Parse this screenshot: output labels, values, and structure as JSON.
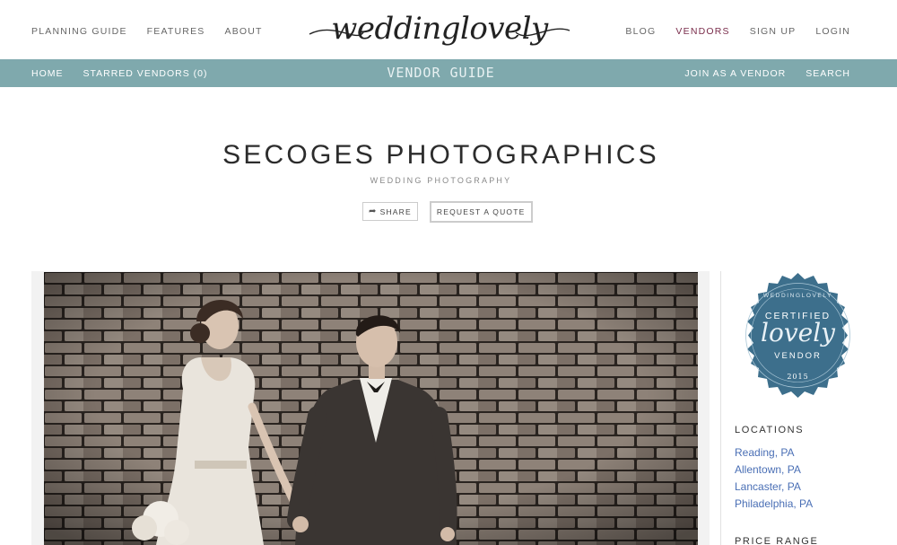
{
  "header": {
    "logo_text": "weddinglovely",
    "left_nav": [
      "PLANNING GUIDE",
      "FEATURES",
      "ABOUT"
    ],
    "right_nav": [
      "BLOG",
      "VENDORS",
      "SIGN UP",
      "LOGIN"
    ],
    "active_item": "VENDORS",
    "active_color": "#7a2d4b"
  },
  "subnav": {
    "bar_color": "#7fa9ad",
    "title": "VENDOR GUIDE",
    "left_items": [
      "HOME",
      "STARRED VENDORS (0)"
    ],
    "right_items": [
      "JOIN AS A VENDOR",
      "SEARCH"
    ]
  },
  "vendor": {
    "name": "SECOGES PHOTOGRAPHICS",
    "category": "WEDDING PHOTOGRAPHY",
    "share_label": "SHARE",
    "share_icon": "share-arrow-icon",
    "quote_label": "REQUEST A QUOTE"
  },
  "badge": {
    "top_text": "WEDDINGLOVELY",
    "line1": "CERTIFIED",
    "script": "lovely",
    "line2": "VENDOR",
    "year": "2015",
    "color": "#3d6f8c"
  },
  "sidebar": {
    "locations_heading": "LOCATIONS",
    "locations": [
      "Reading, PA",
      "Allentown, PA",
      "Lancaster, PA",
      "Philadelphia, PA"
    ],
    "price_heading": "PRICE RANGE",
    "link_color": "#4a6fb5"
  }
}
